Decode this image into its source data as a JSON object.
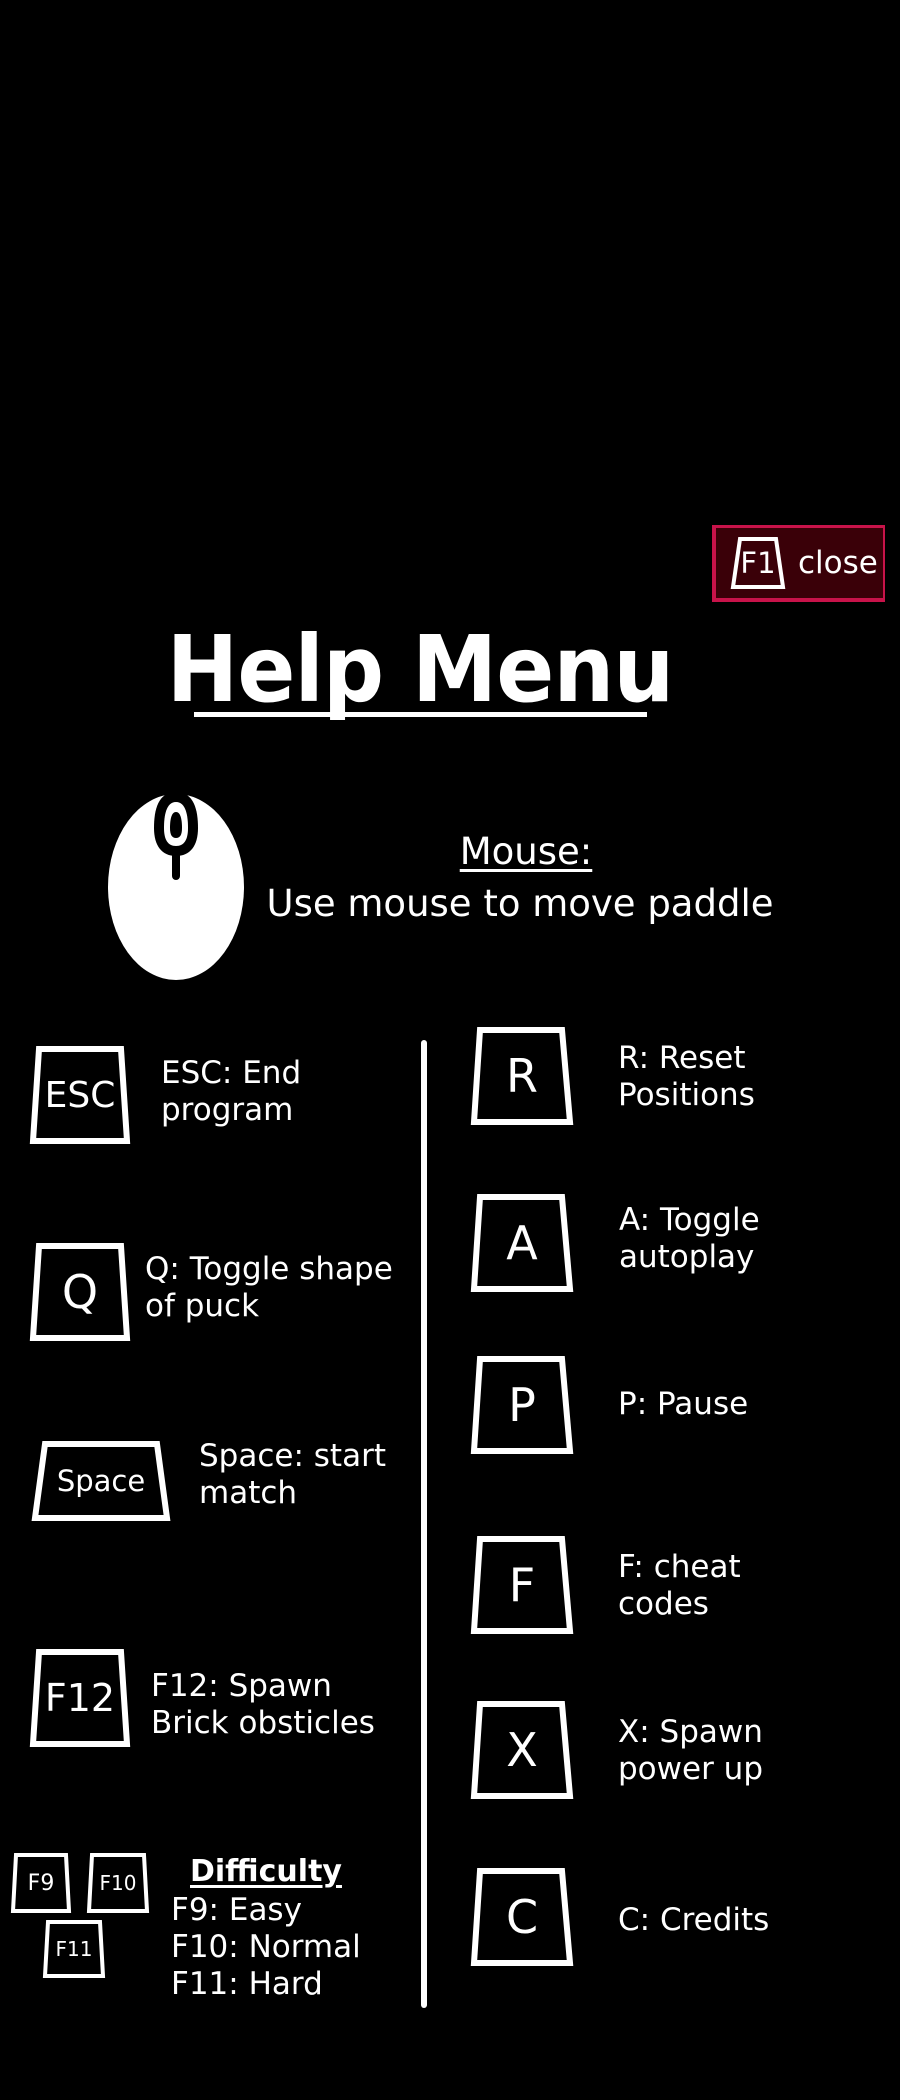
{
  "close_button": {
    "key": "F1",
    "label": "close"
  },
  "title": "Help Menu",
  "mouse": {
    "heading": "Mouse:",
    "description": "Use mouse to move paddle",
    "icon": "mouse-icon"
  },
  "left_keys": [
    {
      "key": "ESC",
      "line1": "ESC: End",
      "line2": "program"
    },
    {
      "key": "Q",
      "line1": "Q: Toggle shape",
      "line2": "of puck"
    },
    {
      "key": "Space",
      "line1": "Space: start",
      "line2": "match"
    },
    {
      "key": "F12",
      "line1": "F12: Spawn",
      "line2": "Brick obsticles"
    }
  ],
  "right_keys": [
    {
      "key": "R",
      "line1": "R: Reset",
      "line2": "Positions"
    },
    {
      "key": "A",
      "line1": "A: Toggle",
      "line2": "autoplay"
    },
    {
      "key": "P",
      "line1": "P: Pause",
      "line2": ""
    },
    {
      "key": "F",
      "line1": "F: cheat",
      "line2": "codes"
    },
    {
      "key": "X",
      "line1": "X: Spawn",
      "line2": "power up"
    },
    {
      "key": "C",
      "line1": "C: Credits",
      "line2": ""
    }
  ],
  "difficulty": {
    "keys": [
      "F9",
      "F10",
      "F11"
    ],
    "title": "Difficulty",
    "lines": [
      "F9: Easy",
      "F10: Normal",
      "F11: Hard"
    ]
  },
  "colors": {
    "background": "#000000",
    "foreground": "#ffffff",
    "close_accent": "#c8134a",
    "close_fill": "#3a0008"
  }
}
